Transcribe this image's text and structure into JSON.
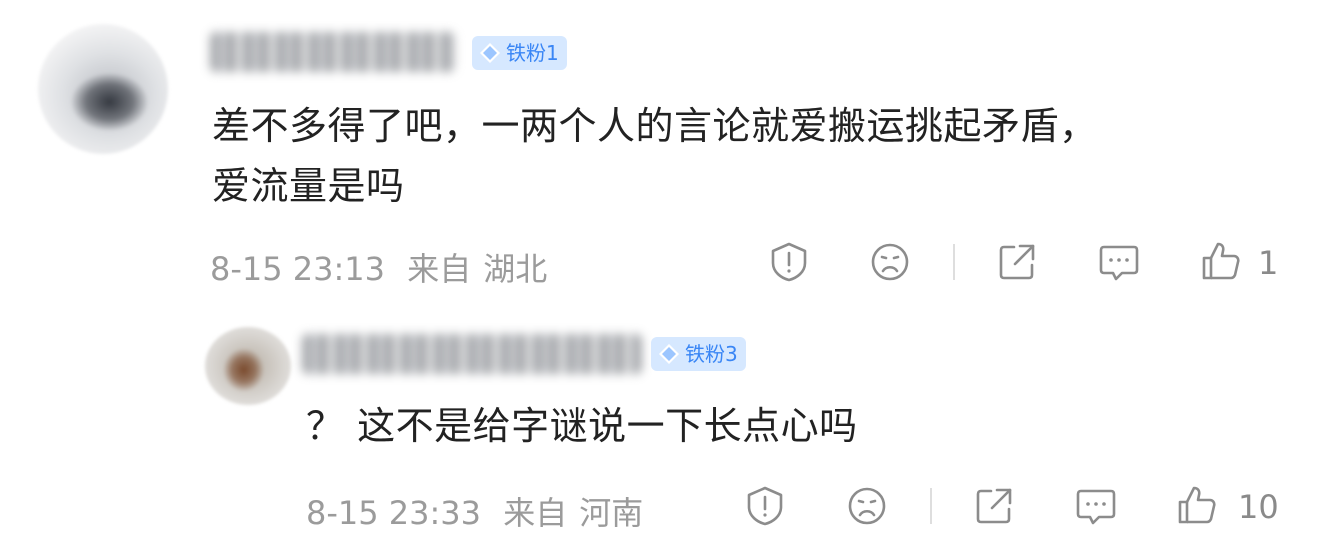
{
  "comment": {
    "badge": "铁粉1",
    "text_line1": "差不多得了吧，一两个人的言论就爱搬运挑起矛盾，",
    "text_line2": "爱流量是吗",
    "date": "8-15 23:13",
    "location_prefix": "来自",
    "location": "湖北",
    "like_count": "1"
  },
  "reply": {
    "badge": "铁粉3",
    "text": "？ 这不是给字谜说一下长点心吗",
    "date": "8-15 23:33",
    "location_prefix": "来自",
    "location": "河南",
    "like_count": "10"
  },
  "colors": {
    "badge_bg": "#d6e8ff",
    "badge_text": "#3a86f5",
    "meta_text": "#9b9b9b",
    "icon_stroke": "#8c8c8c"
  },
  "icons": [
    "report-icon",
    "dislike-face-icon",
    "share-icon",
    "comment-icon",
    "like-icon",
    "diamond-icon"
  ]
}
